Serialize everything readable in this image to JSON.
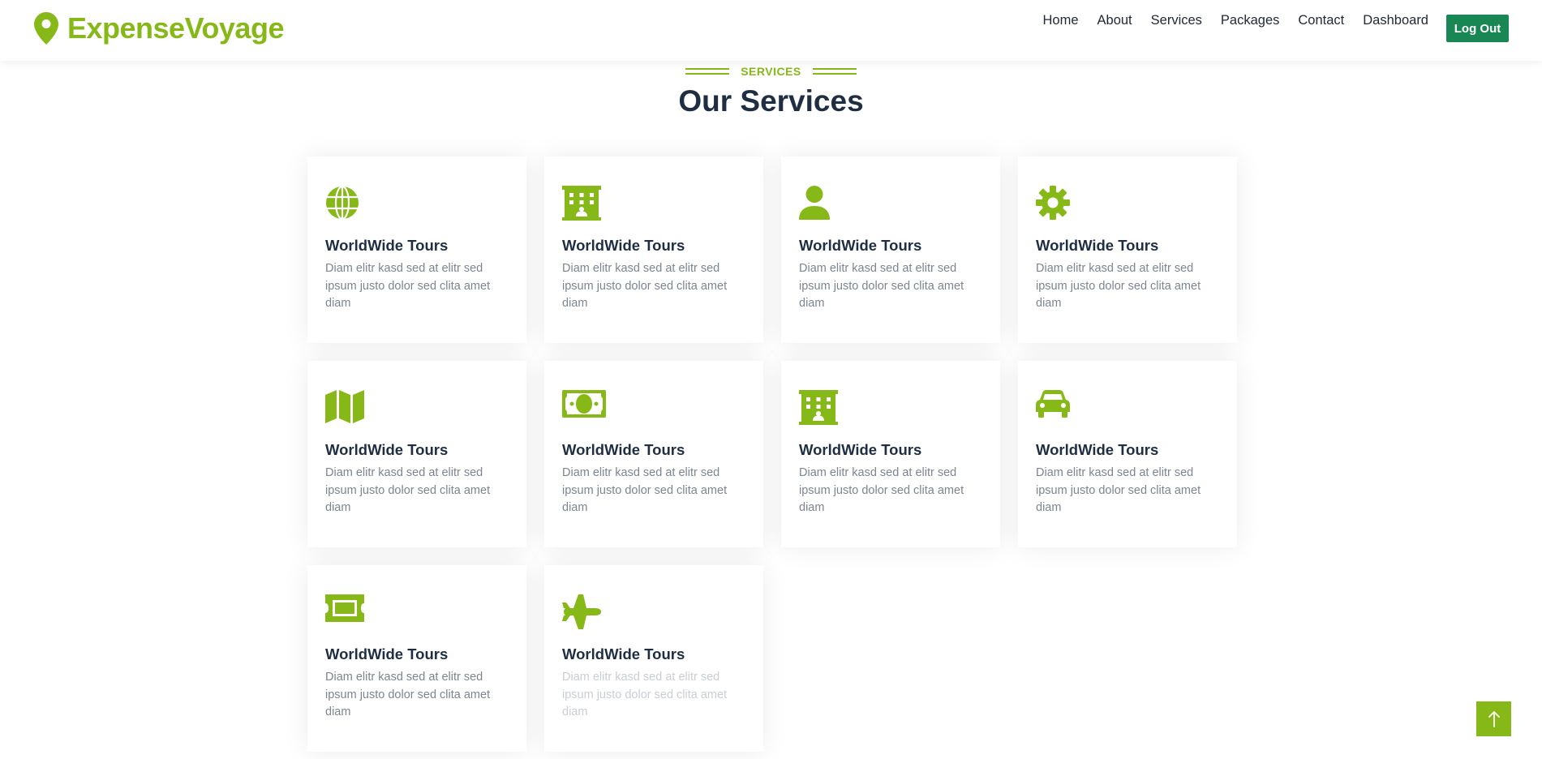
{
  "brand": {
    "name": "ExpenseVoyage",
    "icon": "map-marker-icon",
    "color": "#86b817"
  },
  "nav": {
    "links": [
      "Home",
      "About",
      "Services",
      "Packages",
      "Contact",
      "Dashboard"
    ],
    "logout_label": "Log Out"
  },
  "section": {
    "eyebrow": "SERVICES",
    "title": "Our Services"
  },
  "services": [
    {
      "icon": "globe-icon",
      "title": "WorldWide Tours",
      "text": "Diam elitr kasd sed at elitr sed ipsum justo dolor sed clita amet diam"
    },
    {
      "icon": "hotel-icon",
      "title": "WorldWide Tours",
      "text": "Diam elitr kasd sed at elitr sed ipsum justo dolor sed clita amet diam"
    },
    {
      "icon": "user-icon",
      "title": "WorldWide Tours",
      "text": "Diam elitr kasd sed at elitr sed ipsum justo dolor sed clita amet diam"
    },
    {
      "icon": "gear-icon",
      "title": "WorldWide Tours",
      "text": "Diam elitr kasd sed at elitr sed ipsum justo dolor sed clita amet diam"
    },
    {
      "icon": "map-icon",
      "title": "WorldWide Tours",
      "text": "Diam elitr kasd sed at elitr sed ipsum justo dolor sed clita amet diam"
    },
    {
      "icon": "money-bill-icon",
      "title": "WorldWide Tours",
      "text": "Diam elitr kasd sed at elitr sed ipsum justo dolor sed clita amet diam"
    },
    {
      "icon": "hotel-icon",
      "title": "WorldWide Tours",
      "text": "Diam elitr kasd sed at elitr sed ipsum justo dolor sed clita amet diam"
    },
    {
      "icon": "car-icon",
      "title": "WorldWide Tours",
      "text": "Diam elitr kasd sed at elitr sed ipsum justo dolor sed clita amet diam"
    },
    {
      "icon": "ticket-icon",
      "title": "WorldWide Tours",
      "text": "Diam elitr kasd sed at elitr sed ipsum justo dolor sed clita amet diam"
    },
    {
      "icon": "plane-icon",
      "title": "WorldWide Tours",
      "text": "Diam elitr kasd sed at elitr sed ipsum justo dolor sed clita amet diam"
    }
  ],
  "back_to_top_icon": "arrow-up-icon",
  "colors": {
    "accent": "#86b817",
    "logout": "#198754",
    "heading": "#1f2e43"
  }
}
